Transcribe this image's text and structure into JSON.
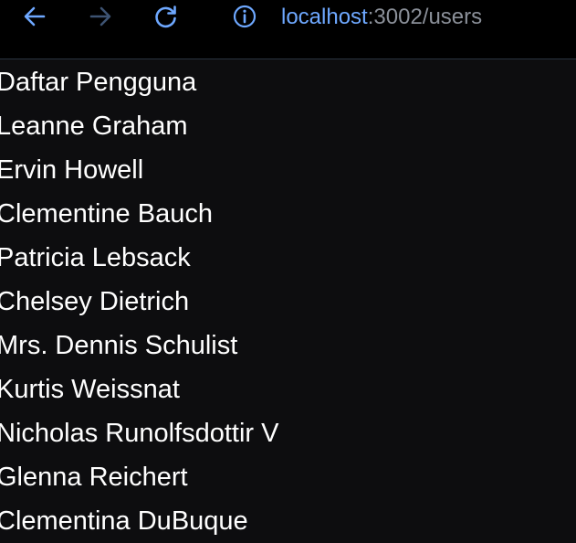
{
  "browser": {
    "address": {
      "host": "localhost",
      "path": ":3002/users"
    },
    "icons": {
      "back": "arrow-left-icon",
      "forward": "arrow-right-icon",
      "reload": "reload-icon",
      "info": "info-icon"
    },
    "colors": {
      "icon_active": "#6ea8ff",
      "icon_disabled": "#3d5372",
      "host": "#6ea8ff",
      "path": "#8a8f98"
    }
  },
  "page": {
    "title": "Daftar Pengguna",
    "users": [
      "Leanne Graham",
      "Ervin Howell",
      "Clementine Bauch",
      "Patricia Lebsack",
      "Chelsey Dietrich",
      "Mrs. Dennis Schulist",
      "Kurtis Weissnat",
      "Nicholas Runolfsdottir V",
      "Glenna Reichert",
      "Clementina DuBuque"
    ],
    "colors": {
      "background": "#0d0d0f",
      "text": "#ffffff"
    }
  }
}
